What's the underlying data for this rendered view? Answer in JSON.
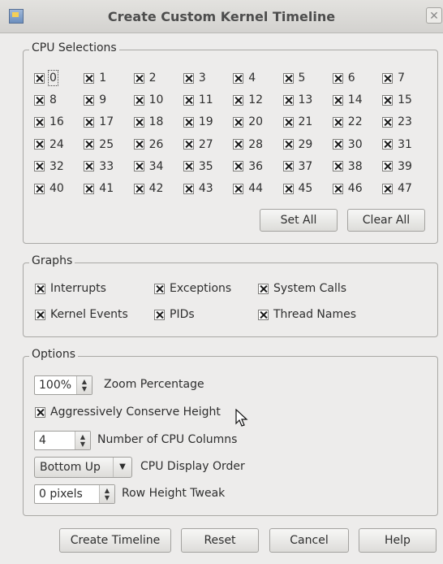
{
  "window": {
    "title": "Create Custom Kernel Timeline",
    "close_glyph": "✕"
  },
  "cpu_selections": {
    "title": "CPU Selections",
    "cpus": [
      "0",
      "1",
      "2",
      "3",
      "4",
      "5",
      "6",
      "7",
      "8",
      "9",
      "10",
      "11",
      "12",
      "13",
      "14",
      "15",
      "16",
      "17",
      "18",
      "19",
      "20",
      "21",
      "22",
      "23",
      "24",
      "25",
      "26",
      "27",
      "28",
      "29",
      "30",
      "31",
      "32",
      "33",
      "34",
      "35",
      "36",
      "37",
      "38",
      "39",
      "40",
      "41",
      "42",
      "43",
      "44",
      "45",
      "46",
      "47"
    ],
    "all_checked": true,
    "set_all": "Set All",
    "clear_all": "Clear All"
  },
  "graphs": {
    "title": "Graphs",
    "items": [
      {
        "label": "Interrupts",
        "checked": true
      },
      {
        "label": "Exceptions",
        "checked": true
      },
      {
        "label": "System Calls",
        "checked": true
      },
      {
        "label": "Kernel Events",
        "checked": true
      },
      {
        "label": "PIDs",
        "checked": true
      },
      {
        "label": "Thread Names",
        "checked": true
      }
    ]
  },
  "options": {
    "title": "Options",
    "zoom_value": "100%",
    "zoom_label": "Zoom Percentage",
    "conserve_label": "Aggressively Conserve Height",
    "conserve_checked": true,
    "columns_value": "4",
    "columns_label": "Number of CPU Columns",
    "order_value": "Bottom Up",
    "order_label": "CPU Display Order",
    "row_height_value": "0 pixels",
    "row_height_label": "Row Height Tweak"
  },
  "buttons": {
    "create": "Create Timeline",
    "reset": "Reset",
    "cancel": "Cancel",
    "help": "Help"
  }
}
